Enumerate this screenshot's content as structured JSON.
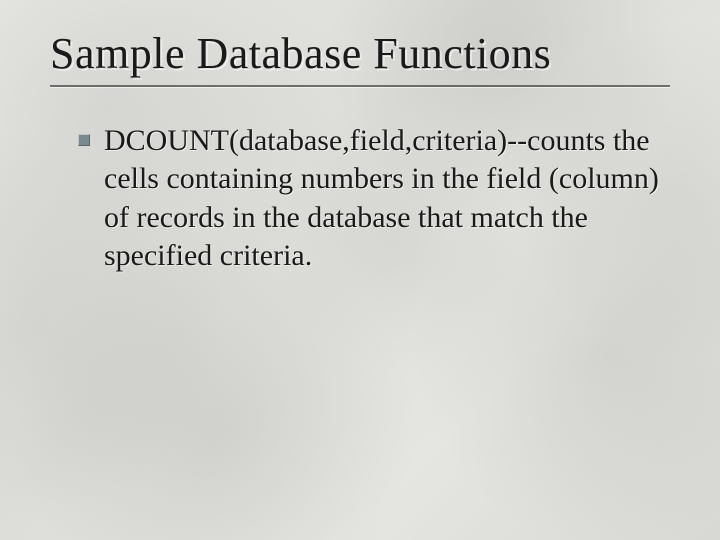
{
  "slide": {
    "title": "Sample Database Functions",
    "bullets": [
      {
        "text": "DCOUNT(database,field,criteria)--counts the cells containing numbers in the field (column) of records in the database that match the specified criteria."
      }
    ]
  }
}
